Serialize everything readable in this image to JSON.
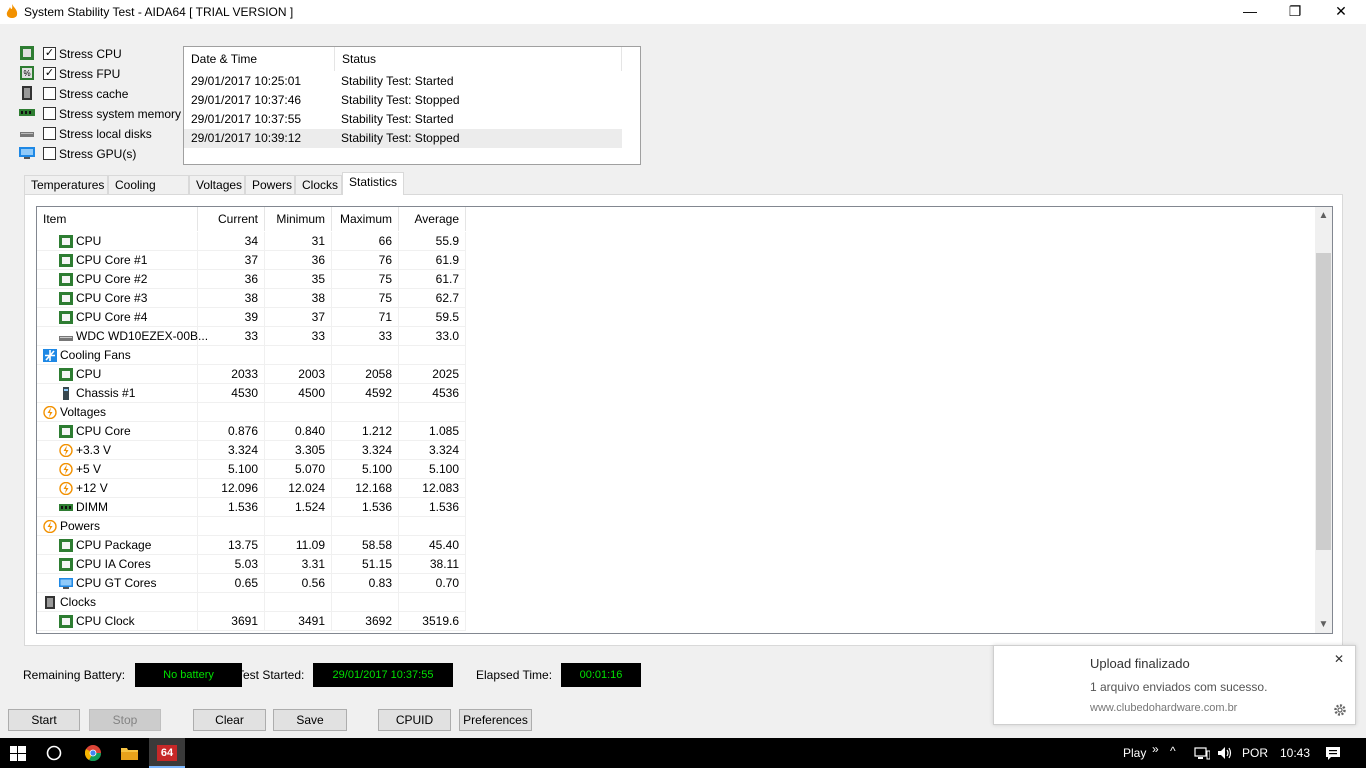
{
  "window": {
    "title": "System Stability Test - AIDA64  [ TRIAL VERSION ]",
    "minimize": "—",
    "maximize": "❐",
    "close": "✕"
  },
  "stress": [
    {
      "label": "Stress CPU",
      "checked": true,
      "check": "✓"
    },
    {
      "label": "Stress FPU",
      "checked": true,
      "check": "✓"
    },
    {
      "label": "Stress cache",
      "checked": false,
      "check": ""
    },
    {
      "label": "Stress system memory",
      "checked": false,
      "check": ""
    },
    {
      "label": "Stress local disks",
      "checked": false,
      "check": ""
    },
    {
      "label": "Stress GPU(s)",
      "checked": false,
      "check": ""
    }
  ],
  "log": {
    "headers": [
      "Date & Time",
      "Status"
    ],
    "rows": [
      {
        "time": "29/01/2017 10:25:01",
        "status": "Stability Test: Started"
      },
      {
        "time": "29/01/2017 10:37:46",
        "status": "Stability Test: Stopped"
      },
      {
        "time": "29/01/2017 10:37:55",
        "status": "Stability Test: Started"
      },
      {
        "time": "29/01/2017 10:39:12",
        "status": "Stability Test: Stopped"
      }
    ]
  },
  "tabs": [
    "Temperatures",
    "Cooling Fans",
    "Voltages",
    "Powers",
    "Clocks",
    "Statistics"
  ],
  "grid": {
    "headers": [
      "Item",
      "Current",
      "Minimum",
      "Maximum",
      "Average"
    ],
    "rows": [
      {
        "indent": 1,
        "icon": "chip-icon",
        "item": "CPU",
        "cur": "34",
        "min": "31",
        "max": "66",
        "avg": "55.9"
      },
      {
        "indent": 1,
        "icon": "chip-icon",
        "item": "CPU Core #1",
        "cur": "37",
        "min": "36",
        "max": "76",
        "avg": "61.9"
      },
      {
        "indent": 1,
        "icon": "chip-icon",
        "item": "CPU Core #2",
        "cur": "36",
        "min": "35",
        "max": "75",
        "avg": "61.7"
      },
      {
        "indent": 1,
        "icon": "chip-icon",
        "item": "CPU Core #3",
        "cur": "38",
        "min": "38",
        "max": "75",
        "avg": "62.7"
      },
      {
        "indent": 1,
        "icon": "chip-icon",
        "item": "CPU Core #4",
        "cur": "39",
        "min": "37",
        "max": "71",
        "avg": "59.5"
      },
      {
        "indent": 1,
        "icon": "disk-icon",
        "item": "WDC WD10EZEX-00B...",
        "cur": "33",
        "min": "33",
        "max": "33",
        "avg": "33.0"
      },
      {
        "indent": 0,
        "icon": "fan-icon",
        "item": "Cooling Fans",
        "cur": "",
        "min": "",
        "max": "",
        "avg": ""
      },
      {
        "indent": 1,
        "icon": "chip-icon",
        "item": "CPU",
        "cur": "2033",
        "min": "2003",
        "max": "2058",
        "avg": "2025"
      },
      {
        "indent": 1,
        "icon": "chassis-icon",
        "item": "Chassis #1",
        "cur": "4530",
        "min": "4500",
        "max": "4592",
        "avg": "4536"
      },
      {
        "indent": 0,
        "icon": "bolt-icon",
        "item": "Voltages",
        "cur": "",
        "min": "",
        "max": "",
        "avg": ""
      },
      {
        "indent": 1,
        "icon": "chip-icon",
        "item": "CPU Core",
        "cur": "0.876",
        "min": "0.840",
        "max": "1.212",
        "avg": "1.085"
      },
      {
        "indent": 1,
        "icon": "bolt-icon",
        "item": "+3.3 V",
        "cur": "3.324",
        "min": "3.305",
        "max": "3.324",
        "avg": "3.324"
      },
      {
        "indent": 1,
        "icon": "bolt-icon",
        "item": "+5 V",
        "cur": "5.100",
        "min": "5.070",
        "max": "5.100",
        "avg": "5.100"
      },
      {
        "indent": 1,
        "icon": "bolt-icon",
        "item": "+12 V",
        "cur": "12.096",
        "min": "12.024",
        "max": "12.168",
        "avg": "12.083"
      },
      {
        "indent": 1,
        "icon": "memory-icon",
        "item": "DIMM",
        "cur": "1.536",
        "min": "1.524",
        "max": "1.536",
        "avg": "1.536"
      },
      {
        "indent": 0,
        "icon": "bolt-icon",
        "item": "Powers",
        "cur": "",
        "min": "",
        "max": "",
        "avg": ""
      },
      {
        "indent": 1,
        "icon": "chip-icon",
        "item": "CPU Package",
        "cur": "13.75",
        "min": "11.09",
        "max": "58.58",
        "avg": "45.40"
      },
      {
        "indent": 1,
        "icon": "chip-icon",
        "item": "CPU IA Cores",
        "cur": "5.03",
        "min": "3.31",
        "max": "51.15",
        "avg": "38.11"
      },
      {
        "indent": 1,
        "icon": "monitor-icon",
        "item": "CPU GT Cores",
        "cur": "0.65",
        "min": "0.56",
        "max": "0.83",
        "avg": "0.70"
      },
      {
        "indent": 0,
        "icon": "clock-chip-icon",
        "item": "Clocks",
        "cur": "",
        "min": "",
        "max": "",
        "avg": ""
      },
      {
        "indent": 1,
        "icon": "chip-icon",
        "item": "CPU Clock",
        "cur": "3691",
        "min": "3491",
        "max": "3692",
        "avg": "3519.6"
      }
    ]
  },
  "status": {
    "battery_label": "Remaining Battery:",
    "battery_value": "No battery",
    "started_label": "Test Started:",
    "started_value": "29/01/2017 10:37:55",
    "elapsed_label": "Elapsed Time:",
    "elapsed_value": "00:01:16"
  },
  "buttons": {
    "start": "Start",
    "stop": "Stop",
    "clear": "Clear",
    "save": "Save",
    "cpuid": "CPUID",
    "preferences": "Preferences"
  },
  "toast": {
    "title": "Upload finalizado",
    "message": "1 arquivo enviados com sucesso.",
    "site": "www.clubedohardware.com.br",
    "close": "✕"
  },
  "taskbar": {
    "play": "Play",
    "chevrons": "»",
    "lang": "POR",
    "time": "10:43",
    "aida": "64"
  },
  "colors": {
    "status_text": "#00e000",
    "status_bg": "#000000",
    "taskbar_bg": "#000000",
    "chip_green": "#2e7d32",
    "fan_blue": "#1e88e5",
    "bolt_orange": "#f29100"
  }
}
